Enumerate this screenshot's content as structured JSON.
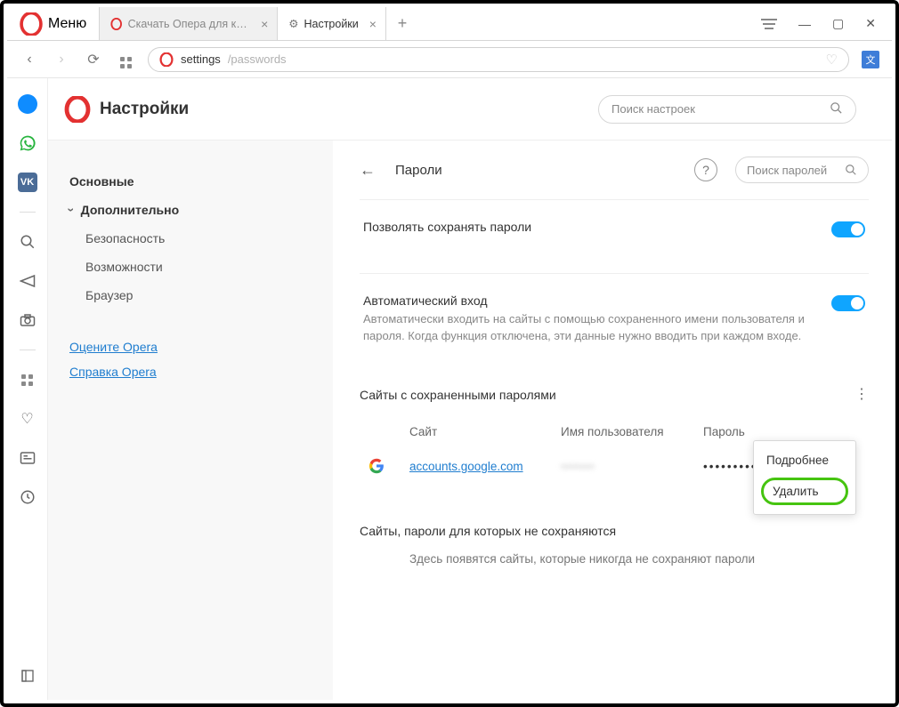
{
  "window": {
    "menu_label": "Меню",
    "tabs": [
      {
        "title": "Скачать Опера для комп",
        "icon": "opera-icon"
      },
      {
        "title": "Настройки",
        "icon": "gear-icon"
      }
    ],
    "active_tab_index": 1
  },
  "addressbar": {
    "url_prefix": "settings",
    "url_suffix": "/passwords"
  },
  "page": {
    "title": "Настройки",
    "settings_search_placeholder": "Поиск настроек"
  },
  "settings_nav": {
    "basic": "Основные",
    "advanced": "Дополнительно",
    "security": "Безопасность",
    "features": "Возможности",
    "browser": "Браузер",
    "rate_link": "Оцените Opera",
    "help_link": "Справка Opera"
  },
  "passwords": {
    "section_title": "Пароли",
    "search_placeholder": "Поиск паролей",
    "allow_save_label": "Позволять сохранять пароли",
    "allow_save_on": true,
    "autologin_title": "Автоматический вход",
    "autologin_desc": "Автоматически входить на сайты с помощью сохраненного имени пользователя и пароля. Когда функция отключена, эти данные нужно вводить при каждом входе.",
    "autologin_on": true,
    "saved_title": "Сайты с сохраненными паролями",
    "columns": {
      "site": "Сайт",
      "user": "Имя пользователя",
      "pass": "Пароль"
    },
    "rows": [
      {
        "site": "accounts.google.com",
        "user": "••••••••",
        "pass": "•••••••••"
      }
    ],
    "context_menu": {
      "details": "Подробнее",
      "delete": "Удалить"
    },
    "never_title": "Сайты, пароли для которых не сохраняются",
    "never_desc": "Здесь появятся сайты, которые никогда не сохраняют пароли"
  }
}
